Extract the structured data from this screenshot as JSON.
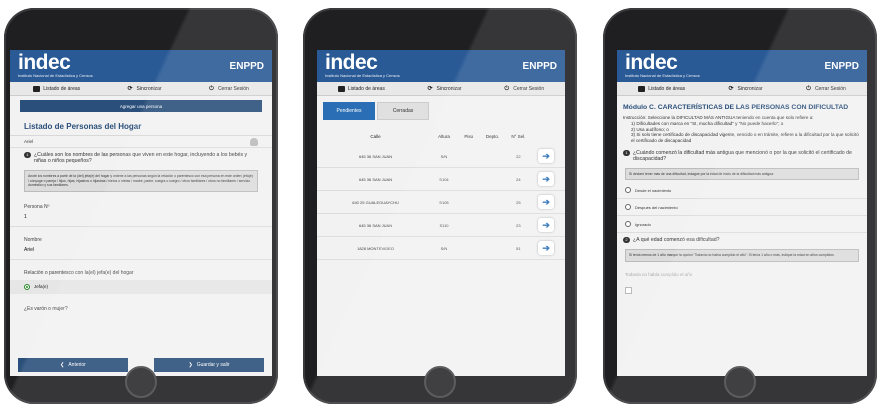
{
  "app": {
    "logo": "indec",
    "logo_sub": "Instituto Nacional de Estadística y Censos",
    "name": "ENPPD"
  },
  "toolbar": {
    "areas": "Listado de áreas",
    "sync": "Sincronizar",
    "logout": "Cerrar Sesión"
  },
  "screen1": {
    "add_person": "Agregar una persona",
    "title": "Listado de Personas del Hogar",
    "person_row": "Ariel",
    "question_num": "1",
    "question": "¿Cuáles son los nombres de las personas que viven en este hogar, incluyendo a los bebés y niñas o niños pequeños?",
    "note": "Anote los nombres a partir de la (del) jefa(e) del hogar y ordene a las personas según la relación o parentesco con esa persona en este orden: jefa(e) / cónyuge o pareja / hijos, hijas, hijastros o hijastras / nietos o nietas / madre, padre, suegra o suegro / otros familiares / otros no familiares / servicio doméstico y sus familiares.",
    "person_no_label": "Persona Nº",
    "person_no_value": "1",
    "name_label": "Nombre",
    "name_value": "Ariel",
    "relation_label": "Relación o parentesco con la(el) jefa(e) del hogar",
    "relation_value": "Jefa(e)",
    "sex_label": "¿Es varón o mujer?",
    "prev": "Anterior",
    "save": "Guardar y salir"
  },
  "screen2": {
    "tabs": [
      "Pendientes",
      "Cerradas"
    ],
    "columns": [
      "Calle",
      "Altura",
      "Piso",
      "Depto.",
      "N° Sel."
    ],
    "rows": [
      {
        "calle": "645 36 SAN JUAN",
        "altura": "S/N",
        "piso": "",
        "depto": "",
        "nsel": "22"
      },
      {
        "calle": "645 36 SAN JUAN",
        "altura": "S104",
        "piso": "",
        "depto": "",
        "nsel": "24"
      },
      {
        "calle": "640 25 GUALEGUAYCHU",
        "altura": "S105",
        "piso": "",
        "depto": "",
        "nsel": "25"
      },
      {
        "calle": "645 36 SAN JUAN",
        "altura": "S110",
        "piso": "",
        "depto": "",
        "nsel": "23"
      },
      {
        "calle": "1828 MONTEVIDEO",
        "altura": "S/N",
        "piso": "",
        "depto": "",
        "nsel": "51"
      }
    ]
  },
  "screen3": {
    "title": "Módulo C. CARACTERÍSTICAS DE LAS PERSONAS CON DIFICULTAD",
    "instruction": "Instrucción: Seleccione la DIFICULTAD MÁS ANTIGUA teniendo en cuenta que solo refiere a:",
    "items": [
      "1) Dificultades con marca en \"SI, mucha dificultad\" y \"No puede hacerlo\"; o",
      "2) Usa audífono; o",
      "3) Si solo tiene certificado de discapacidad vigente, vencido o en trámite, refiere a la dificultad por la que solicitó el certificado de discapacidad"
    ],
    "q1_num": "1",
    "q1": "¿Cuándo comenzó la dificultad más antigua que mencionó o por la que solicitó el certificado de discapacidad?",
    "note1": "Si declaró tener más de una dificultad, indague por la edad de inicio de la dificultad más antigua.",
    "options": [
      "Desde el nacimiento",
      "Después del nacimiento",
      "Ignorado"
    ],
    "q2_num": "2",
    "q2": "¿A qué edad comenzó esa dificultad?",
    "note2": "Si tenía menos de 1 año marque la opción \"Todavía no había cumplido el año\". Si tenía 1 año o más, indique la edad en años cumplidos",
    "muted": "Todavía no había cumplido el año"
  }
}
